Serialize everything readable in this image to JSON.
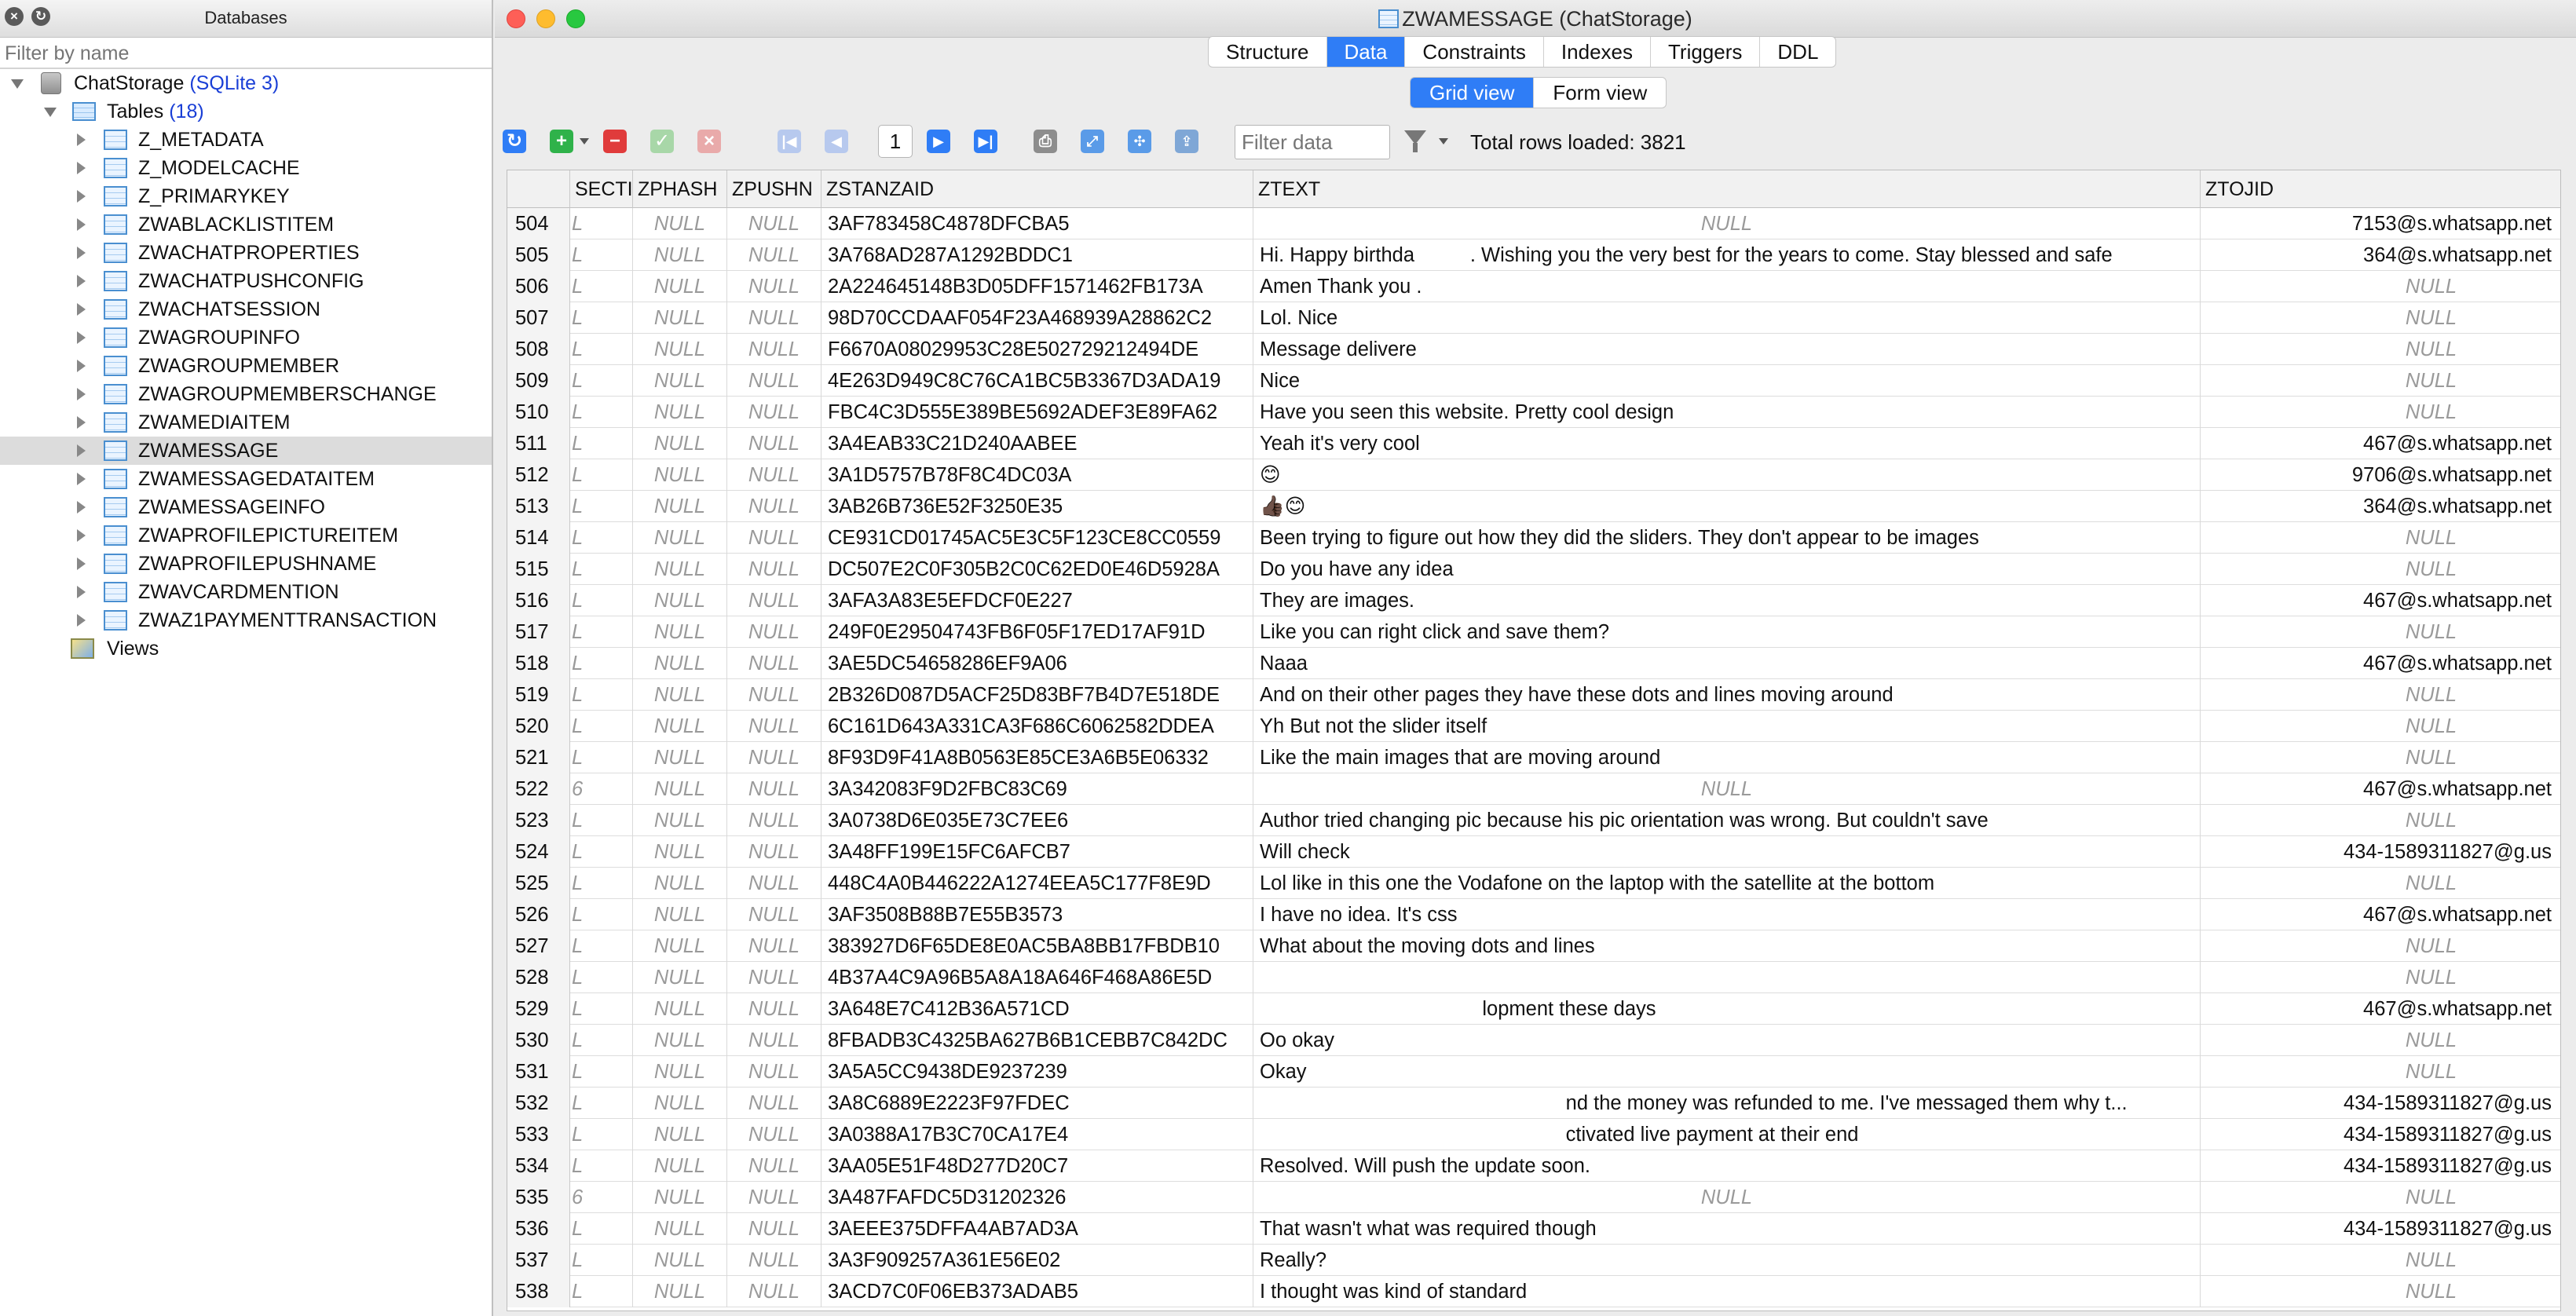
{
  "db_panel": {
    "title": "Databases",
    "filter_placeholder": "Filter by name",
    "database": {
      "name": "ChatStorage",
      "type": "(SQLite 3)"
    },
    "tables_label": "Tables",
    "tables_count": "(18)",
    "tables": [
      "Z_METADATA",
      "Z_MODELCACHE",
      "Z_PRIMARYKEY",
      "ZWABLACKLISTITEM",
      "ZWACHATPROPERTIES",
      "ZWACHATPUSHCONFIG",
      "ZWACHATSESSION",
      "ZWAGROUPINFO",
      "ZWAGROUPMEMBER",
      "ZWAGROUPMEMBERSCHANGE",
      "ZWAMEDIAITEM",
      "ZWAMESSAGE",
      "ZWAMESSAGEDATAITEM",
      "ZWAMESSAGEINFO",
      "ZWAPROFILEPICTUREITEM",
      "ZWAPROFILEPUSHNAME",
      "ZWAVCARDMENTION",
      "ZWAZ1PAYMENTTRANSACTION"
    ],
    "selected_table": "ZWAMESSAGE",
    "views_label": "Views"
  },
  "window": {
    "title": "ZWAMESSAGE (ChatStorage)"
  },
  "tabs": [
    "Structure",
    "Data",
    "Constraints",
    "Indexes",
    "Triggers",
    "DDL"
  ],
  "active_tab": "Data",
  "view_modes": [
    "Grid view",
    "Form view"
  ],
  "active_view": "Grid view",
  "toolbar": {
    "page_number": "1",
    "filter_placeholder": "Filter data",
    "rows_loaded": "Total rows loaded: 3821"
  },
  "grid": {
    "columns": [
      "SECTI",
      "ZPHASH",
      "ZPUSHN",
      "ZSTANZAID",
      "ZTEXT",
      "ZTOJID"
    ],
    "null_text": "NULL",
    "rows": [
      {
        "n": "504",
        "sect": "L",
        "stanza": "3AF783458C4878DFCBA5",
        "text": null,
        "tojid": "7153@s.whatsapp.net"
      },
      {
        "n": "505",
        "sect": "L",
        "stanza": "3A768AD287A1292BDDC1",
        "text": "Hi. Happy birthda          . Wishing you the very best for the years to come. Stay blessed and safe",
        "tojid": "364@s.whatsapp.net"
      },
      {
        "n": "506",
        "sect": "L",
        "stanza": "2A224645148B3D05DFF1571462FB173A",
        "text": "Amen Thank you .",
        "tojid": null
      },
      {
        "n": "507",
        "sect": "L",
        "stanza": "98D70CCDAAF054F23A468939A28862C2",
        "text": "Lol. Nice",
        "tojid": null
      },
      {
        "n": "508",
        "sect": "L",
        "stanza": "F6670A08029953C28E502729212494DE",
        "text": "Message delivere",
        "tojid": null
      },
      {
        "n": "509",
        "sect": "L",
        "stanza": "4E263D949C8C76CA1BC5B3367D3ADA19",
        "text": "Nice",
        "tojid": null
      },
      {
        "n": "510",
        "sect": "L",
        "stanza": "FBC4C3D555E389BE5692ADEF3E89FA62",
        "text": "Have you seen this website. Pretty cool design",
        "tojid": null
      },
      {
        "n": "511",
        "sect": "L",
        "stanza": "3A4EAB33C21D240AABEE",
        "text": "Yeah it's very cool",
        "tojid": "467@s.whatsapp.net"
      },
      {
        "n": "512",
        "sect": "L",
        "stanza": "3A1D5757B78F8C4DC03A",
        "text": "😊",
        "tojid": "9706@s.whatsapp.net"
      },
      {
        "n": "513",
        "sect": "L",
        "stanza": "3AB26B736E52F3250E35",
        "text": "👍🏿😊",
        "tojid": "364@s.whatsapp.net"
      },
      {
        "n": "514",
        "sect": "L",
        "stanza": "CE931CD01745AC5E3C5F123CE8CC0559",
        "text": "Been trying to figure out how they did the sliders. They don't appear to be images",
        "tojid": null
      },
      {
        "n": "515",
        "sect": "L",
        "stanza": "DC507E2C0F305B2C0C62ED0E46D5928A",
        "text": "Do you have any idea",
        "tojid": null
      },
      {
        "n": "516",
        "sect": "L",
        "stanza": "3AFA3A83E5EFDCF0E227",
        "text": "They are images.",
        "tojid": "467@s.whatsapp.net"
      },
      {
        "n": "517",
        "sect": "L",
        "stanza": "249F0E29504743FB6F05F17ED17AF91D",
        "text": "Like you can right click and save them?",
        "tojid": null
      },
      {
        "n": "518",
        "sect": "L",
        "stanza": "3AE5DC54658286EF9A06",
        "text": "Naaa",
        "tojid": "467@s.whatsapp.net"
      },
      {
        "n": "519",
        "sect": "L",
        "stanza": "2B326D087D5ACF25D83BF7B4D7E518DE",
        "text": "And on their other pages they have these dots and lines moving around",
        "tojid": null
      },
      {
        "n": "520",
        "sect": "L",
        "stanza": "6C161D643A331CA3F686C6062582DDEA",
        "text": "Yh But not the slider itself",
        "tojid": null
      },
      {
        "n": "521",
        "sect": "L",
        "stanza": "8F93D9F41A8B0563E85CE3A6B5E06332",
        "text": "Like the main images that are moving around",
        "tojid": null
      },
      {
        "n": "522",
        "sect": "6",
        "stanza": "3A342083F9D2FBC83C69",
        "text": null,
        "tojid": "467@s.whatsapp.net"
      },
      {
        "n": "523",
        "sect": "L",
        "stanza": "3A0738D6E035E73C7EE6",
        "text": "Author tried changing pic because his pic orientation was wrong. But couldn't save",
        "tojid": null
      },
      {
        "n": "524",
        "sect": "L",
        "stanza": "3A48FF199E15FC6AFCB7",
        "text": "Will check",
        "tojid": "434-1589311827@g.us"
      },
      {
        "n": "525",
        "sect": "L",
        "stanza": "448C4A0B446222A1274EEA5C177F8E9D",
        "text": "Lol like in this one the Vodafone on the laptop with the satellite at the bottom",
        "tojid": null
      },
      {
        "n": "526",
        "sect": "L",
        "stanza": "3AF3508B88B7E55B3573",
        "text": "I have no idea. It's css",
        "tojid": "467@s.whatsapp.net"
      },
      {
        "n": "527",
        "sect": "L",
        "stanza": "383927D6F65DE8E0AC5BA8BB17FBDB10",
        "text": "What about the moving dots and lines",
        "tojid": null
      },
      {
        "n": "528",
        "sect": "L",
        "stanza": "4B37A4C9A96B5A8A18A646F468A86E5D",
        "text": "",
        "tojid": null
      },
      {
        "n": "529",
        "sect": "L",
        "stanza": "3A648E7C412B36A571CD",
        "text": "                                        lopment these days",
        "tojid": "467@s.whatsapp.net"
      },
      {
        "n": "530",
        "sect": "L",
        "stanza": "8FBADB3C4325BA627B6B1CEBB7C842DC",
        "text": "Oo okay",
        "tojid": null
      },
      {
        "n": "531",
        "sect": "L",
        "stanza": "3A5A5CC9438DE9237239",
        "text": "Okay",
        "tojid": null
      },
      {
        "n": "532",
        "sect": "L",
        "stanza": "3A8C6889E2223F97FDEC",
        "text": "                                                       nd the money was refunded to me. I've messaged them why t...",
        "tojid": "434-1589311827@g.us"
      },
      {
        "n": "533",
        "sect": "L",
        "stanza": "3A0388A17B3C70CA17E4",
        "text": "                                                       ctivated live payment at their end",
        "tojid": "434-1589311827@g.us"
      },
      {
        "n": "534",
        "sect": "L",
        "stanza": "3AA05E51F48D277D20C7",
        "text": "Resolved. Will push the update soon.",
        "tojid": "434-1589311827@g.us"
      },
      {
        "n": "535",
        "sect": "6",
        "stanza": "3A487FAFDC5D31202326",
        "text": null,
        "tojid": null
      },
      {
        "n": "536",
        "sect": "L",
        "stanza": "3AEEE375DFFA4AB7AD3A",
        "text": "That wasn't what was required though",
        "tojid": "434-1589311827@g.us"
      },
      {
        "n": "537",
        "sect": "L",
        "stanza": "3A3F909257A361E56E02",
        "text": "Really?",
        "tojid": null
      },
      {
        "n": "538",
        "sect": "L",
        "stanza": "3ACD7C0F06EB373ADAB5",
        "text": "I thought was kind of standard",
        "tojid": null
      }
    ]
  }
}
